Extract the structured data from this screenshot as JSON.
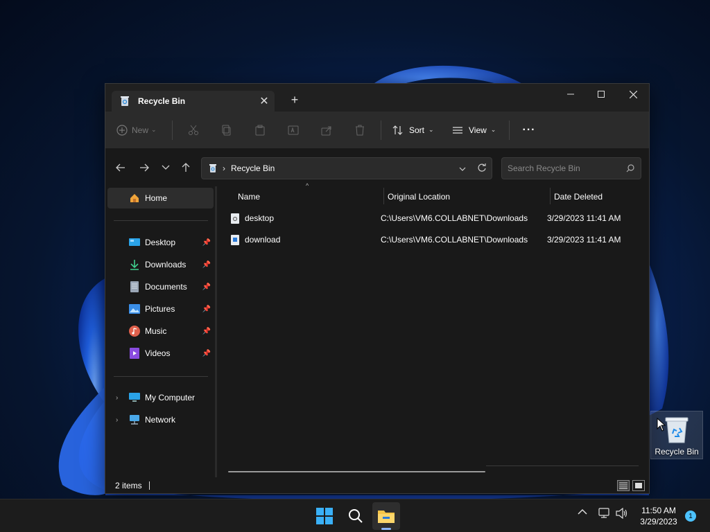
{
  "window": {
    "tab_title": "Recycle Bin",
    "tab_close": "✕",
    "new_tab": "+"
  },
  "toolbar": {
    "new_label": "New",
    "sort_label": "Sort",
    "view_label": "View",
    "more_label": "···"
  },
  "address": {
    "path": "Recycle Bin",
    "separator": "›"
  },
  "search": {
    "placeholder": "Search Recycle Bin"
  },
  "sidebar": {
    "home": "Home",
    "quick": [
      {
        "label": "Desktop",
        "icon": "desktop-icon"
      },
      {
        "label": "Downloads",
        "icon": "downloads-icon"
      },
      {
        "label": "Documents",
        "icon": "documents-icon"
      },
      {
        "label": "Pictures",
        "icon": "pictures-icon"
      },
      {
        "label": "Music",
        "icon": "music-icon"
      },
      {
        "label": "Videos",
        "icon": "videos-icon"
      }
    ],
    "tree": [
      {
        "label": "My Computer",
        "icon": "computer-icon"
      },
      {
        "label": "Network",
        "icon": "network-icon"
      }
    ]
  },
  "columns": {
    "name": "Name",
    "location": "Original Location",
    "date": "Date Deleted"
  },
  "files": [
    {
      "name": "desktop",
      "location": "C:\\Users\\VM6.COLLABNET\\Downloads",
      "date": "3/29/2023 11:41 AM"
    },
    {
      "name": "download",
      "location": "C:\\Users\\VM6.COLLABNET\\Downloads",
      "date": "3/29/2023 11:41 AM"
    }
  ],
  "status": {
    "count": "2 items"
  },
  "desktop_icon": {
    "label": "Recycle Bin"
  },
  "taskbar": {
    "time": "11:50 AM",
    "date": "3/29/2023",
    "notif_count": "1"
  },
  "colors": {
    "accent": "#4cc2ff",
    "window_bg": "#191919",
    "toolbar_bg": "#2b2b2b"
  }
}
